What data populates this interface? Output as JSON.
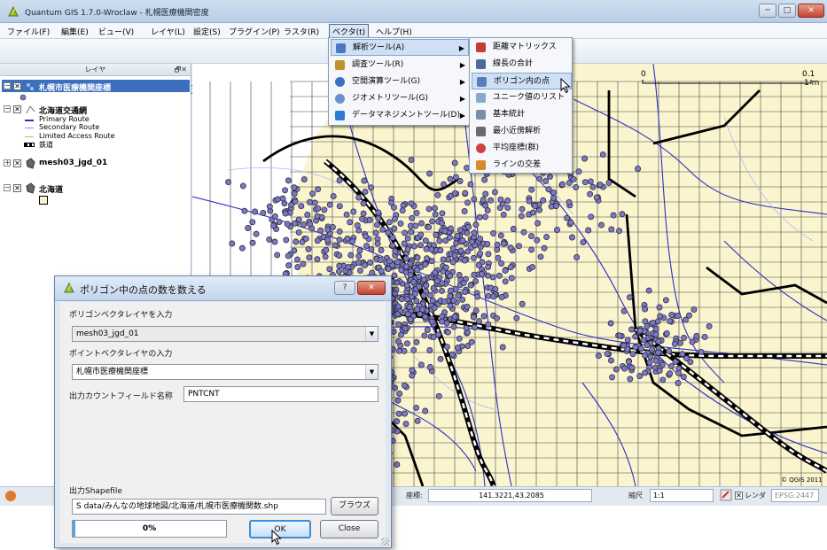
{
  "window": {
    "title": "Quantum GIS 1.7.0-Wroclaw - 札幌医療機関密度",
    "controls": [
      "minimize",
      "maximize",
      "close"
    ]
  },
  "menubar": {
    "items": [
      "ファイル(F)",
      "編集(E)",
      "ビュー(V)",
      "レイヤ(L)",
      "設定(S)",
      "プラグイン(P)",
      "ラスタ(R)",
      "ベクタ(t)",
      "ヘルプ(H)"
    ],
    "active_index": 7
  },
  "legend_panel": {
    "title": "レイヤ",
    "layers": [
      {
        "name": "札幌市医療機関座標",
        "checked": true,
        "selected": true
      },
      {
        "name": "北海道交通網",
        "checked": true,
        "children": [
          "Primary Route",
          "Secondary Route",
          "Limited Access Route",
          "鉄道"
        ]
      },
      {
        "name": "mesh03_jgd_01",
        "checked": true
      },
      {
        "name": "北海道",
        "checked": true
      }
    ]
  },
  "vector_menu": {
    "items": [
      {
        "label": "解析ツール(A)",
        "has_submenu": true,
        "highlighted": true,
        "icon": "analysis-icon"
      },
      {
        "label": "調査ツール(R)",
        "has_submenu": true,
        "icon": "research-icon"
      },
      {
        "label": "空間演算ツール(G)",
        "has_submenu": true,
        "icon": "geoprocessing-icon"
      },
      {
        "label": "ジオメトリツール(G)",
        "has_submenu": true,
        "icon": "geometry-icon"
      },
      {
        "label": "データマネジメントツール(D)",
        "has_submenu": true,
        "icon": "data-management-icon"
      }
    ]
  },
  "analysis_submenu": {
    "items": [
      {
        "label": "距離マトリックス",
        "icon": "distance-matrix-icon"
      },
      {
        "label": "線長の合計",
        "icon": "sum-lines-icon"
      },
      {
        "label": "ポリゴン内の点",
        "icon": "points-in-polygon-icon",
        "highlighted": true
      },
      {
        "label": "ユニーク値のリスト",
        "icon": "unique-values-icon"
      },
      {
        "label": "基本統計",
        "icon": "basic-stats-icon"
      },
      {
        "label": "最小近傍解析",
        "icon": "nearest-neighbour-icon"
      },
      {
        "label": "平均座標(群)",
        "icon": "mean-coordinates-icon"
      },
      {
        "label": "ラインの交差",
        "icon": "line-intersections-icon"
      }
    ]
  },
  "map": {
    "scale_label_left": "0",
    "scale_label_right": "0.1",
    "scale_label_right_2": "1 m",
    "copyright": "© QGIS 2011"
  },
  "statusbar": {
    "coord_label": "座標:",
    "coord_value": "141.3221,43.2085",
    "scale_label": "縮尺",
    "scale_value": "1:1",
    "render_label": "レンダ",
    "epsg": "EPSG:2447"
  },
  "dialog": {
    "title": "ポリゴン中の点の数を数える",
    "polygon_layer_label": "ポリゴンベクタレイヤを入力",
    "polygon_layer_value": "mesh03_jgd_01",
    "point_layer_label": "ポイントベクタレイヤの入力",
    "point_layer_value": "札幌市医療機関座標",
    "count_field_label": "出力カウントフィールド名称",
    "count_field_value": "PNTCNT",
    "output_label": "出力Shapefile",
    "output_value": "S data/みんなの地球地図/北海道/札幌市医療機関数.shp",
    "browse_label": "ブラウズ",
    "progress_text": "0%",
    "progress": 0,
    "ok_label": "OK",
    "close_label": "Close",
    "help_glyph": "?",
    "close_glyph": "✕"
  },
  "colors": {
    "accent": "#3d6fbf",
    "points": "#7b78c9",
    "grid_fill": "#fbf5cf",
    "roads": "#2c2ec7"
  }
}
